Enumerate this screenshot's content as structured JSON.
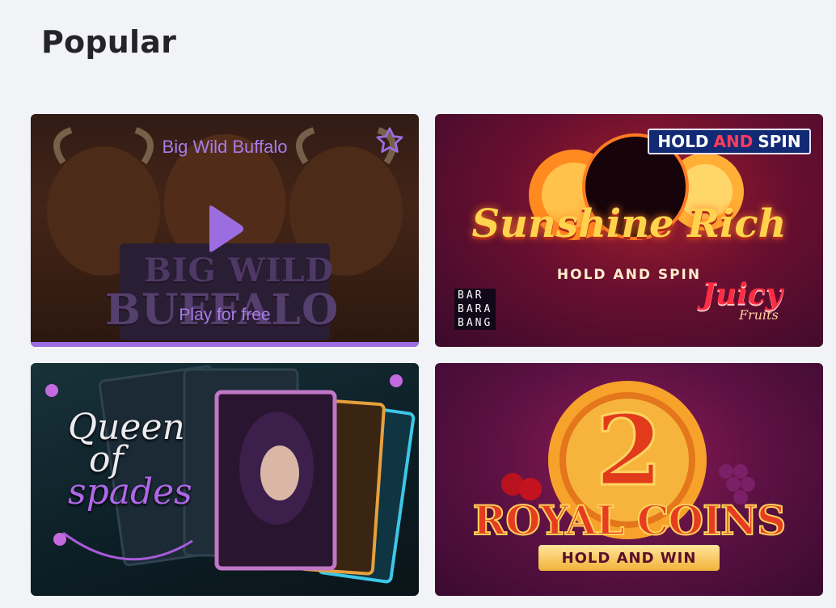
{
  "section": {
    "title": "Popular"
  },
  "games": [
    {
      "name": "Big Wild Buffalo",
      "art_text_line1": "BIG WILD",
      "art_text_line2": "BUFFALO",
      "play_label": "Play for free",
      "hovered": true,
      "accent_color": "#9b6de0"
    },
    {
      "badge": {
        "hold": "HOLD",
        "and": "AND",
        "spin": "SPIN"
      },
      "title": "Sunshine Rich",
      "subtitle": "HOLD AND SPIN",
      "provider_lines": [
        "BAR",
        "BARA",
        "BANG"
      ],
      "brand": "Juicy",
      "brand_sub": "Fruits"
    },
    {
      "title_line1": "Queen",
      "title_line2": "of",
      "title_line3": "spades"
    },
    {
      "number": "2",
      "title": "ROYAL COINS",
      "subtitle": "HOLD AND WIN"
    }
  ],
  "icons": {
    "favorite": "star-outline-icon",
    "play": "play-icon"
  }
}
